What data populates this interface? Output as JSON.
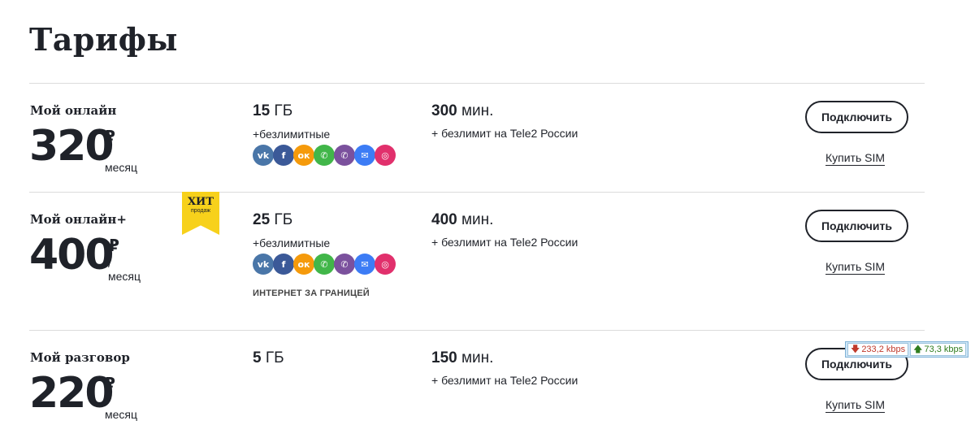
{
  "page": {
    "title": "Тарифы"
  },
  "icons": [
    {
      "name": "vk-icon",
      "glyph": "vk",
      "color": "#4a76a8"
    },
    {
      "name": "facebook-icon",
      "glyph": "f",
      "color": "#3b5998"
    },
    {
      "name": "odnoklassniki-icon",
      "glyph": "ок",
      "color": "#f59a0b"
    },
    {
      "name": "whatsapp-icon",
      "glyph": "✆",
      "color": "#41b649"
    },
    {
      "name": "viber-icon",
      "glyph": "✆",
      "color": "#7b519d"
    },
    {
      "name": "messenger-icon",
      "glyph": "✉",
      "color": "#3c7cf5"
    },
    {
      "name": "instagram-icon",
      "glyph": "◎",
      "color": "#e1306c"
    }
  ],
  "plans": [
    {
      "name": "Мой онлайн",
      "price": "320",
      "currency": "₽",
      "period": "/месяц",
      "data_value": "15",
      "data_unit": "ГБ",
      "unlimited_label": "+безлимитные",
      "minutes_value": "300",
      "minutes_unit": "мин.",
      "minutes_sub": "+ безлимит на Tele2 России",
      "connect_label": "Подключить",
      "buy_label": "Купить SIM"
    },
    {
      "name": "Мой онлайн+",
      "price": "400",
      "currency": "₽",
      "period": "/месяц",
      "data_value": "25",
      "data_unit": "ГБ",
      "unlimited_label": "+безлимитные",
      "abroad_label": "ИНТЕРНЕТ ЗА ГРАНИЦЕЙ",
      "minutes_value": "400",
      "minutes_unit": "мин.",
      "minutes_sub": "+ безлимит на Tele2 России",
      "connect_label": "Подключить",
      "buy_label": "Купить SIM",
      "badge": {
        "title": "ХИТ",
        "subtitle": "продаж",
        "color": "#f7d11b"
      }
    },
    {
      "name": "Мой разговор",
      "price": "220",
      "currency": "₽",
      "period": "/месяц",
      "data_value": "5",
      "data_unit": "ГБ",
      "minutes_value": "150",
      "minutes_unit": "мин.",
      "minutes_sub": "+ безлимит на Tele2 России",
      "connect_label": "Подключить",
      "buy_label": "Купить SIM"
    }
  ],
  "speed_widget": {
    "download": "233,2 kbps",
    "upload": "73,3 kbps"
  }
}
